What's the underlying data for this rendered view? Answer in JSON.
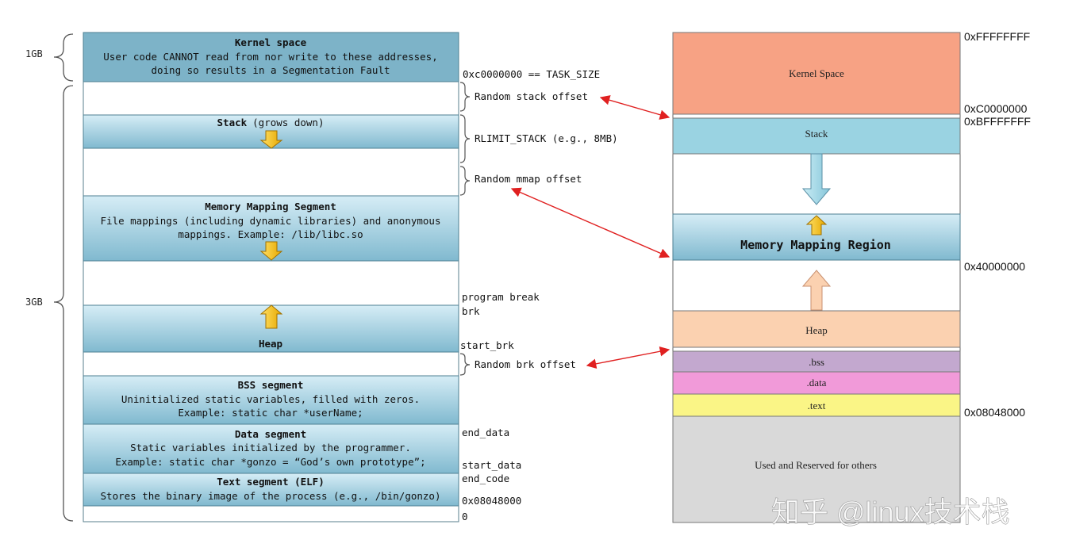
{
  "left": {
    "size_1gb": "1GB",
    "size_3gb": "3GB",
    "kernel": {
      "title": "Kernel space",
      "line1": "User code CANNOT read from nor write to these addresses,",
      "line2": "doing so results in a Segmentation Fault"
    },
    "stack": {
      "title": "Stack",
      "suffix": "(grows down)"
    },
    "mmap": {
      "title": "Memory Mapping Segment",
      "line1": "File mappings (including dynamic libraries) and anonymous",
      "line2": "mappings. Example: /lib/libc.so"
    },
    "heap": {
      "title": "Heap"
    },
    "bss": {
      "title": "BSS segment",
      "line1": "Uninitialized static variables, filled with zeros.",
      "line2": "Example: static char *userName;"
    },
    "data": {
      "title": "Data segment",
      "line1": "Static variables initialized by the programmer.",
      "line2": "Example: static char *gonzo = “God’s own prototype”;"
    },
    "text": {
      "title": "Text segment (ELF)",
      "line1": "Stores the binary image of the process (e.g., /bin/gonzo)"
    },
    "labels": {
      "task_size": "0xc0000000 == TASK_SIZE",
      "random_stack": "Random stack offset",
      "rlimit_stack": "RLIMIT_STACK (e.g., 8MB)",
      "random_mmap": "Random mmap offset",
      "program_break": "program break",
      "brk": "brk",
      "start_brk": "start_brk",
      "random_brk": "Random brk offset",
      "end_data": "end_data",
      "start_data": "start_data",
      "end_code": "end_code",
      "addr_08048000": "0x08048000",
      "zero": "0"
    }
  },
  "right": {
    "kernel_space": "Kernel Space",
    "stack": "Stack",
    "mmap_region": "Memory Mapping Region",
    "heap": "Heap",
    "bss": ".bss",
    "data": ".data",
    "text": ".text",
    "reserved": "Used and Reserved for others",
    "addresses": {
      "top": "0xFFFFFFFF",
      "c0": "0xC0000000",
      "bf": "0xBFFFFFFF",
      "mmap_base": "0x40000000",
      "text_base": "0x08048000"
    }
  },
  "watermark": "知乎 @linux技术栈",
  "colors": {
    "segment_blue_top": "#d4ecf5",
    "segment_blue_bottom": "#7fb9cf",
    "segment_border": "#4d7f92",
    "kernel_orange": "#f7a284",
    "stack_blue": "#9ad3e2",
    "heap_peach": "#fbd1b0",
    "bss_purple": "#c3a8cf",
    "data_pink": "#f19ad9",
    "text_yellow": "#faf586",
    "reserved_gray": "#d9d9d9",
    "arrow_red": "#e02020",
    "up_arrow_gold": "#f5c000"
  }
}
